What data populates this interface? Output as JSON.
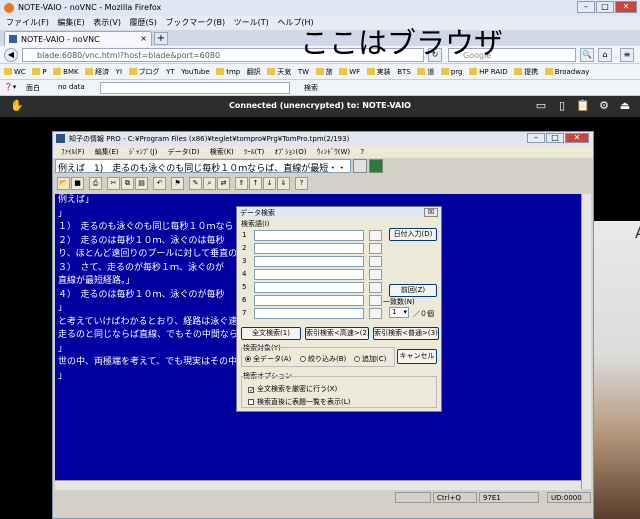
{
  "firefox": {
    "title": "NOTE-VAIO - noVNC - Mozilla Firefox",
    "menu": [
      "ファイル(F)",
      "編集(E)",
      "表示(V)",
      "履歴(S)",
      "ブックマーク(B)",
      "ツール(T)",
      "ヘルプ(H)"
    ],
    "tab_label": "NOTE-VAIO - noVNC",
    "newtab": "+",
    "url": "blade:6080/vnc.html?host=blade&port=6080",
    "search_placeholder": "Google",
    "overlay_caption": "ここはブラウザ",
    "bookmarks": [
      "WC",
      "P",
      "BMK",
      "経済",
      "YI",
      "ブログ",
      "YT",
      "YouTube",
      "tmp",
      "翻訳",
      "天気",
      "TW",
      "旅",
      "WF",
      "実装",
      "BTS",
      "道",
      "prg",
      "HP RAID",
      "提携",
      "Broadway"
    ],
    "toolbar2_face": "面白",
    "toolbar2_nodata": "no data",
    "toolbar2_search": "検索"
  },
  "vnc": {
    "status": "Connected (unencrypted) to: NOTE-VAIO"
  },
  "app": {
    "title": "知子の情報 PRO - C:¥Program Files (x86)¥teglet¥tompro¥Prg¥TomPro.tpm(2/193)",
    "menu": [
      "ﾌｧｲﾙ(F)",
      "編集(E)",
      "ｼﾞｬﾝﾌﾟ(J)",
      "データ(D)",
      "検索(K)",
      "ﾂｰﾙ(T)",
      "ｵﾌﾟｼｮﾝ(O)",
      "ｳｨﾝﾄﾞｳ(W)",
      "?"
    ],
    "query": "例えば　1)　走るのも泳ぐのも同じ毎秒１０ｍならば、直線が最短・・・",
    "body_lines": [
      "例えば」",
      "」",
      "１）　走るのも泳ぐのも同じ毎秒１０ｍなら",
      "２）　走るのは毎秒１０ｍ、泳ぐのは毎秒",
      "り、ほとんど遠回りのプールに対して垂直の",
      "３）　さて、走るのが毎秒１ｍ、泳ぐのが",
      "直線が最短経路。」",
      "４）　走るのは毎秒１０ｍ、泳ぐのが毎秒",
      "」",
      "と考えていけばわかるとおり、経路は泳ぐ速",
      "走るのと同じならば直線、でもその中間なら",
      "」",
      "世の中、両極端を考えて、でも現実はその中",
      "」"
    ],
    "status": {
      "keys": "Ctrl+Q",
      "code": "97E1",
      "ud": "UD:0000"
    }
  },
  "dialog": {
    "title": "データ検索",
    "close": "☒",
    "words_label": "検索語(I)",
    "rows": [
      "1",
      "2",
      "3",
      "4",
      "5",
      "6",
      "7"
    ],
    "date_button": "日付入力(D)",
    "prev_button": "前回(Z)",
    "match_label": "一致数(N)",
    "match_value": "1",
    "match_total": "／０個",
    "btn_full": "全文検索(1)",
    "btn_idx_fast": "索引検索<高速>(2)",
    "btn_idx_normal": "索引検索<普通>(3)",
    "target_label": "検索対象(Y)",
    "target_all": "全データ(A)",
    "target_narrow": "絞り込み(B)",
    "target_add": "追加(C)",
    "cancel": "キャンセル",
    "options_label": "検索オプション",
    "opt1": "全文検索を厳密に行う(X)",
    "opt2": "検索直後に表題一覧を表示(L)"
  }
}
